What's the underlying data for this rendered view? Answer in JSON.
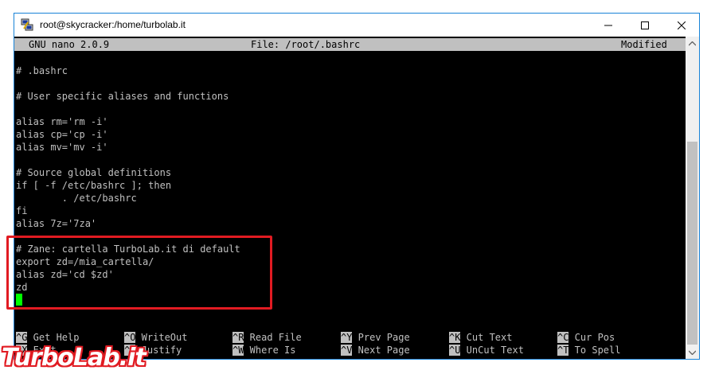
{
  "window": {
    "title": "root@skycracker:/home/turbolab.it"
  },
  "nano": {
    "version": "GNU nano 2.0.9",
    "file": "File: /root/.bashrc",
    "status": "Modified"
  },
  "lines": [
    "# .bashrc",
    "# User specific aliases and functions",
    "alias rm='rm -i'",
    "alias cp='cp -i'",
    "alias mv='mv -i'",
    "# Source global definitions",
    "if [ -f /etc/bashrc ]; then",
    "        . /etc/bashrc",
    "fi",
    "alias 7z='7za'",
    "# Zane: cartella TurboLab.it di default",
    "export zd=/mia_cartella/",
    "alias zd='cd $zd'",
    "zd"
  ],
  "shortcuts": [
    {
      "key": "^G",
      "label": " Get Help"
    },
    {
      "key": "^O",
      "label": " WriteOut"
    },
    {
      "key": "^R",
      "label": " Read File"
    },
    {
      "key": "^Y",
      "label": " Prev Page"
    },
    {
      "key": "^K",
      "label": " Cut Text"
    },
    {
      "key": "^C",
      "label": " Cur Pos"
    },
    {
      "key": "^X",
      "label": " Exit"
    },
    {
      "key": "^J",
      "label": " Justify"
    },
    {
      "key": "^W",
      "label": " Where Is"
    },
    {
      "key": "^V",
      "label": " Next Page"
    },
    {
      "key": "^U",
      "label": " UnCut Text"
    },
    {
      "key": "^T",
      "label": " To Spell"
    }
  ],
  "watermark": "TurboLab.it",
  "colors": {
    "terminal_bg": "#000000",
    "terminal_fg": "#c0c0c0",
    "cursor": "#00ff00",
    "highlight_border": "#e11b22",
    "window_border": "#1883d7"
  }
}
